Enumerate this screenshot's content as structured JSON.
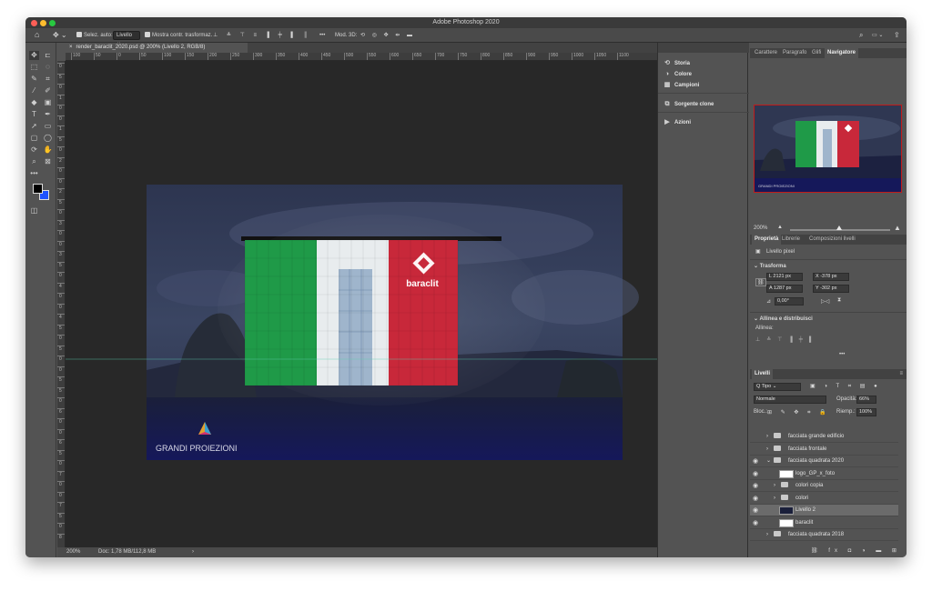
{
  "window": {
    "title": "Adobe Photoshop 2020"
  },
  "colors": {
    "traffic_red": "#ff5f57",
    "traffic_yellow": "#febc2e",
    "traffic_green": "#28c840",
    "green": "#1f9a48",
    "white": "#e8ecee",
    "red": "#c8283a",
    "accent_blue": "#1f52ff"
  },
  "options_bar": {
    "auto_select_label": "Selez. auto:",
    "auto_select_value": "Livello",
    "show_transform_label": "Mostra contr. trasformaz.",
    "more": "•••",
    "mode3d_label": "Mod. 3D:"
  },
  "document": {
    "tab_title": "render_baraclit_2020.psd @ 200% (Livello 2, RGB/8)",
    "zoom": "200%",
    "doc_size": "Doc: 1,78 MB/112,8 MB",
    "logo_text": "baraclit",
    "brand_text": "GRANDI PROIEZIONI",
    "ruler_top": [
      "100",
      "50",
      "0",
      "50",
      "100",
      "150",
      "200",
      "250",
      "300",
      "350",
      "400",
      "450",
      "500",
      "550",
      "600",
      "650",
      "700",
      "750",
      "800",
      "850",
      "900",
      "950",
      "1000",
      "1050",
      "1100"
    ],
    "ruler_left": [
      "0",
      "5",
      "0",
      "1",
      "0",
      "0",
      "1",
      "5",
      "0",
      "2",
      "0",
      "0",
      "2",
      "5",
      "0",
      "3",
      "0",
      "0",
      "3",
      "5",
      "0",
      "4",
      "0",
      "0",
      "4",
      "5",
      "0",
      "5",
      "0",
      "0",
      "5",
      "5",
      "0",
      "6",
      "0",
      "0",
      "6",
      "5",
      "0",
      "7",
      "0",
      "0",
      "7",
      "5",
      "0",
      "8"
    ]
  },
  "mid_panel": {
    "items": [
      {
        "icon": "history-icon",
        "glyph": "⟲",
        "label": "Storia"
      },
      {
        "icon": "color-icon",
        "glyph": "◑",
        "label": "Colore"
      },
      {
        "icon": "swatches-icon",
        "glyph": "▦",
        "label": "Campioni"
      },
      {
        "icon": "clone-source-icon",
        "glyph": "⧉",
        "label": "Sorgente clone"
      },
      {
        "icon": "actions-icon",
        "glyph": "▶",
        "label": "Azioni"
      }
    ]
  },
  "top_tabs": [
    "Carattere",
    "Paragrafo",
    "Glifi",
    "Navigatore"
  ],
  "navigator": {
    "zoom": "200%",
    "brand_text": "GRANDI PROIEZIONI"
  },
  "properties": {
    "tabs": [
      "Proprietà",
      "Librerie",
      "Composizioni livelli"
    ],
    "layer_type": "Livello pixel",
    "transform_title": "Trasforma",
    "width": "L  2121 px",
    "x": "X  -378 px",
    "height": "A  1287 px",
    "y": "Y  -302 px",
    "angle": "0,00°",
    "align_title": "Allinea e distribuisci",
    "align_label": "Allinea:",
    "more": "•••"
  },
  "layers_panel": {
    "title": "Livelli",
    "kind": "Q Tipo",
    "blend_mode": "Normale",
    "opacity_label": "Opacità:",
    "opacity": "66%",
    "lock_label": "Bloc.:",
    "fill_label": "Riemp.:",
    "fill": "100%",
    "layers": [
      {
        "name": "facciata grande edificio",
        "type": "folder",
        "indent": 0,
        "visible": false,
        "active": false
      },
      {
        "name": "facciata frontale",
        "type": "folder",
        "indent": 0,
        "visible": false,
        "active": false
      },
      {
        "name": "facciata quadrata 2020",
        "type": "folder",
        "indent": 0,
        "visible": true,
        "active": false
      },
      {
        "name": "logo_GP_x_foto",
        "type": "smart",
        "indent": 1,
        "visible": true,
        "active": false
      },
      {
        "name": "colori copia",
        "type": "folder",
        "indent": 1,
        "visible": true,
        "active": false
      },
      {
        "name": "colori",
        "type": "folder",
        "indent": 1,
        "visible": true,
        "active": false
      },
      {
        "name": "Livello 2",
        "type": "pixel",
        "indent": 1,
        "visible": true,
        "active": true
      },
      {
        "name": "baraclit",
        "type": "smart",
        "indent": 1,
        "visible": true,
        "active": false
      },
      {
        "name": "facciata quadrata 2018",
        "type": "folder",
        "indent": 0,
        "visible": false,
        "active": false
      }
    ]
  }
}
